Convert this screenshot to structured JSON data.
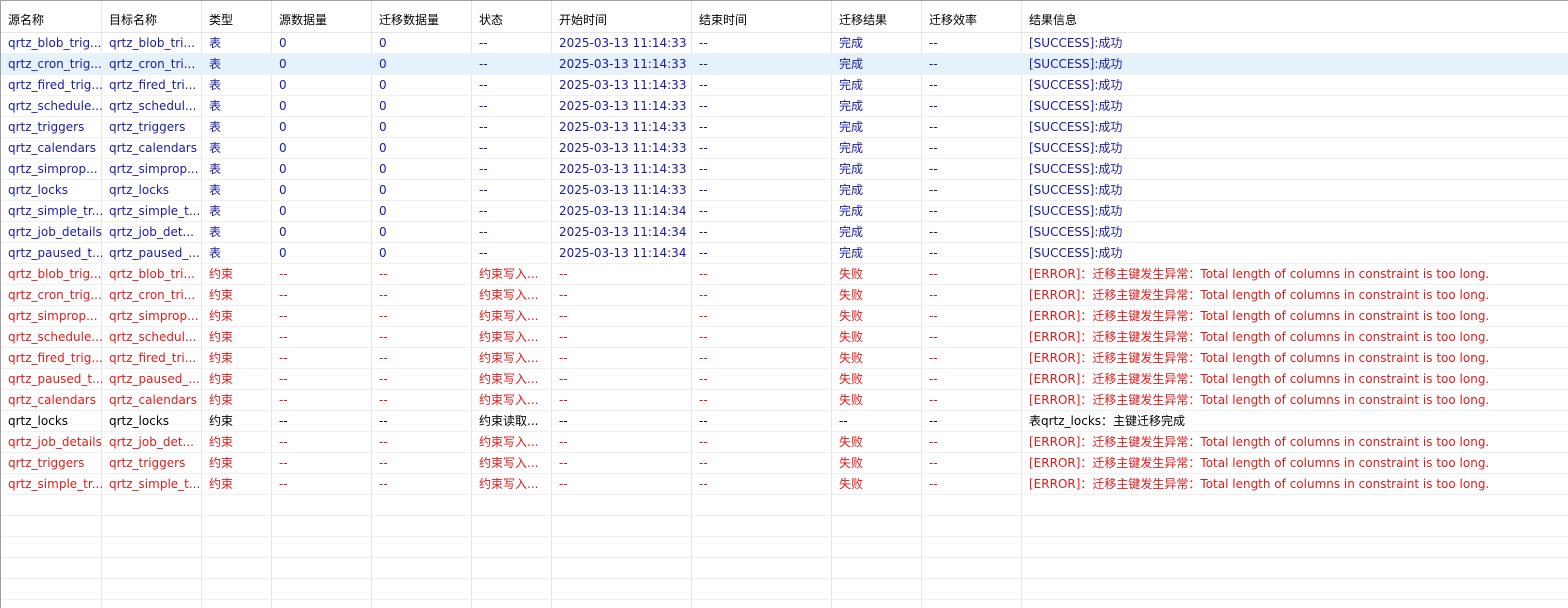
{
  "columns": [
    "源名称",
    "目标名称",
    "类型",
    "源数据量",
    "迁移数据量",
    "状态",
    "开始时间",
    "结束时间",
    "迁移结果",
    "迁移效率",
    "结果信息"
  ],
  "colors": {
    "success": "#1a1aa8",
    "error": "#e01b1b",
    "neutral": "#000000",
    "selected_row": "#e5f1fb"
  },
  "rows": [
    {
      "cells": [
        "qrtz_blob_trig...",
        "qrtz_blob_tri...",
        "表",
        "0",
        "0",
        "--",
        "2025-03-13 11:14:33",
        "--",
        "完成",
        "--",
        "[SUCCESS]:成功"
      ],
      "status": "success"
    },
    {
      "cells": [
        "qrtz_cron_trig...",
        "qrtz_cron_tri...",
        "表",
        "0",
        "0",
        "--",
        "2025-03-13 11:14:33",
        "--",
        "完成",
        "--",
        "[SUCCESS]:成功"
      ],
      "status": "success",
      "selected": true
    },
    {
      "cells": [
        "qrtz_fired_trig...",
        "qrtz_fired_tri...",
        "表",
        "0",
        "0",
        "--",
        "2025-03-13 11:14:33",
        "--",
        "完成",
        "--",
        "[SUCCESS]:成功"
      ],
      "status": "success"
    },
    {
      "cells": [
        "qrtz_schedule...",
        "qrtz_schedul...",
        "表",
        "0",
        "0",
        "--",
        "2025-03-13 11:14:33",
        "--",
        "完成",
        "--",
        "[SUCCESS]:成功"
      ],
      "status": "success"
    },
    {
      "cells": [
        "qrtz_triggers",
        "qrtz_triggers",
        "表",
        "0",
        "0",
        "--",
        "2025-03-13 11:14:33",
        "--",
        "完成",
        "--",
        "[SUCCESS]:成功"
      ],
      "status": "success"
    },
    {
      "cells": [
        "qrtz_calendars",
        "qrtz_calendars",
        "表",
        "0",
        "0",
        "--",
        "2025-03-13 11:14:33",
        "--",
        "完成",
        "--",
        "[SUCCESS]:成功"
      ],
      "status": "success"
    },
    {
      "cells": [
        "qrtz_simprop...",
        "qrtz_simprop...",
        "表",
        "0",
        "0",
        "--",
        "2025-03-13 11:14:33",
        "--",
        "完成",
        "--",
        "[SUCCESS]:成功"
      ],
      "status": "success"
    },
    {
      "cells": [
        "qrtz_locks",
        "qrtz_locks",
        "表",
        "0",
        "0",
        "--",
        "2025-03-13 11:14:33",
        "--",
        "完成",
        "--",
        "[SUCCESS]:成功"
      ],
      "status": "success"
    },
    {
      "cells": [
        "qrtz_simple_tr...",
        "qrtz_simple_t...",
        "表",
        "0",
        "0",
        "--",
        "2025-03-13 11:14:34",
        "--",
        "完成",
        "--",
        "[SUCCESS]:成功"
      ],
      "status": "success"
    },
    {
      "cells": [
        "qrtz_job_details",
        "qrtz_job_det...",
        "表",
        "0",
        "0",
        "--",
        "2025-03-13 11:14:34",
        "--",
        "完成",
        "--",
        "[SUCCESS]:成功"
      ],
      "status": "success"
    },
    {
      "cells": [
        "qrtz_paused_t...",
        "qrtz_paused_...",
        "表",
        "0",
        "0",
        "--",
        "2025-03-13 11:14:34",
        "--",
        "完成",
        "--",
        "[SUCCESS]:成功"
      ],
      "status": "success"
    },
    {
      "cells": [
        "qrtz_blob_trig...",
        "qrtz_blob_tri...",
        "约束",
        "--",
        "--",
        "约束写入...",
        "--",
        "--",
        "失败",
        "--",
        "[ERROR]：迁移主键发生异常：Total length of columns in constraint is too long."
      ],
      "status": "error"
    },
    {
      "cells": [
        "qrtz_cron_trig...",
        "qrtz_cron_tri...",
        "约束",
        "--",
        "--",
        "约束写入...",
        "--",
        "--",
        "失败",
        "--",
        "[ERROR]：迁移主键发生异常：Total length of columns in constraint is too long."
      ],
      "status": "error"
    },
    {
      "cells": [
        "qrtz_simprop...",
        "qrtz_simprop...",
        "约束",
        "--",
        "--",
        "约束写入...",
        "--",
        "--",
        "失败",
        "--",
        "[ERROR]：迁移主键发生异常：Total length of columns in constraint is too long."
      ],
      "status": "error"
    },
    {
      "cells": [
        "qrtz_schedule...",
        "qrtz_schedul...",
        "约束",
        "--",
        "--",
        "约束写入...",
        "--",
        "--",
        "失败",
        "--",
        "[ERROR]：迁移主键发生异常：Total length of columns in constraint is too long."
      ],
      "status": "error"
    },
    {
      "cells": [
        "qrtz_fired_trig...",
        "qrtz_fired_tri...",
        "约束",
        "--",
        "--",
        "约束写入...",
        "--",
        "--",
        "失败",
        "--",
        "[ERROR]：迁移主键发生异常：Total length of columns in constraint is too long."
      ],
      "status": "error"
    },
    {
      "cells": [
        "qrtz_paused_t...",
        "qrtz_paused_...",
        "约束",
        "--",
        "--",
        "约束写入...",
        "--",
        "--",
        "失败",
        "--",
        "[ERROR]：迁移主键发生异常：Total length of columns in constraint is too long."
      ],
      "status": "error"
    },
    {
      "cells": [
        "qrtz_calendars",
        "qrtz_calendars",
        "约束",
        "--",
        "--",
        "约束写入...",
        "--",
        "--",
        "失败",
        "--",
        "[ERROR]：迁移主键发生异常：Total length of columns in constraint is too long."
      ],
      "status": "error"
    },
    {
      "cells": [
        "qrtz_locks",
        "qrtz_locks",
        "约束",
        "--",
        "--",
        "约束读取...",
        "--",
        "--",
        "--",
        "--",
        "表qrtz_locks：主键迁移完成"
      ],
      "status": "neutral"
    },
    {
      "cells": [
        "qrtz_job_details",
        "qrtz_job_det...",
        "约束",
        "--",
        "--",
        "约束写入...",
        "--",
        "--",
        "失败",
        "--",
        "[ERROR]：迁移主键发生异常：Total length of columns in constraint is too long."
      ],
      "status": "error"
    },
    {
      "cells": [
        "qrtz_triggers",
        "qrtz_triggers",
        "约束",
        "--",
        "--",
        "约束写入...",
        "--",
        "--",
        "失败",
        "--",
        "[ERROR]：迁移主键发生异常：Total length of columns in constraint is too long."
      ],
      "status": "error"
    },
    {
      "cells": [
        "qrtz_simple_tr...",
        "qrtz_simple_t...",
        "约束",
        "--",
        "--",
        "约束写入...",
        "--",
        "--",
        "失败",
        "--",
        "[ERROR]：迁移主键发生异常：Total length of columns in constraint is too long."
      ],
      "status": "error"
    }
  ]
}
